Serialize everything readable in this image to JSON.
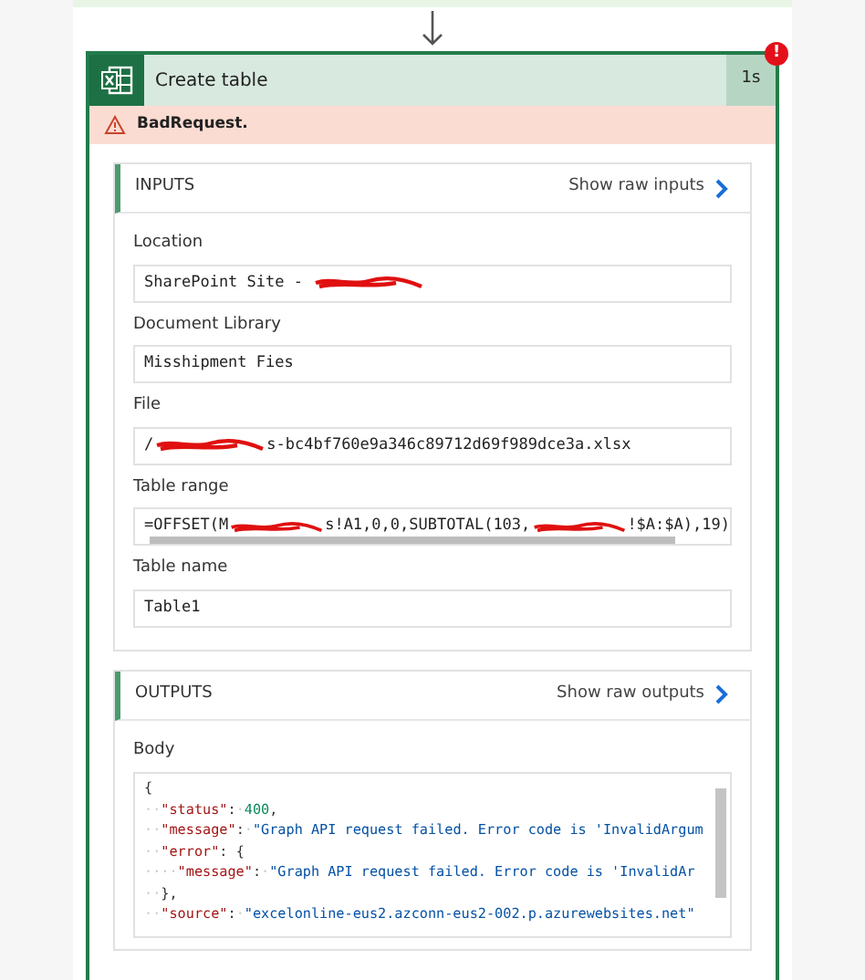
{
  "action": {
    "title": "Create table",
    "duration": "1s",
    "error_badge": "!",
    "error": "BadRequest."
  },
  "inputs": {
    "title": "INPUTS",
    "raw_link": "Show raw inputs",
    "fields": [
      {
        "label": "Location",
        "value": [
          {
            "kind": "text",
            "text": "SharePoint Site - "
          },
          {
            "kind": "redacted"
          }
        ]
      },
      {
        "label": "Document Library",
        "value": [
          {
            "kind": "text",
            "text": "Misshipment Fies"
          }
        ]
      },
      {
        "label": "File",
        "value": [
          {
            "kind": "text",
            "text": "/"
          },
          {
            "kind": "redacted"
          },
          {
            "kind": "text",
            "text": "s-bc4bf760e9a346c89712d69f989dce3a.xlsx"
          }
        ]
      },
      {
        "label": "Table range",
        "value": [
          {
            "kind": "text",
            "text": "=OFFSET(M"
          },
          {
            "kind": "redacted"
          },
          {
            "kind": "text",
            "text": "s!A1,0,0,SUBTOTAL(103,"
          },
          {
            "kind": "redacted"
          },
          {
            "kind": "text",
            "text": "!$A:$A),19)"
          }
        ],
        "scrollable": true
      },
      {
        "label": "Table name",
        "value": [
          {
            "kind": "text",
            "text": "Table1"
          }
        ]
      }
    ]
  },
  "outputs": {
    "title": "OUTPUTS",
    "raw_link": "Show raw outputs",
    "body_label": "Body",
    "code": [
      [
        {
          "kind": "punct",
          "text": "{"
        }
      ],
      [
        {
          "kind": "indent",
          "text": "··"
        },
        {
          "kind": "key",
          "text": "\"status\""
        },
        {
          "kind": "punct",
          "text": ":"
        },
        {
          "kind": "indent",
          "text": "·"
        },
        {
          "kind": "number",
          "text": "400"
        },
        {
          "kind": "punct",
          "text": ","
        }
      ],
      [
        {
          "kind": "indent",
          "text": "··"
        },
        {
          "kind": "key",
          "text": "\"message\""
        },
        {
          "kind": "punct",
          "text": ":"
        },
        {
          "kind": "indent",
          "text": "·"
        },
        {
          "kind": "string",
          "text": "\"Graph API request failed. Error code is 'InvalidArgum"
        }
      ],
      [
        {
          "kind": "indent",
          "text": "··"
        },
        {
          "kind": "key",
          "text": "\"error\""
        },
        {
          "kind": "punct",
          "text": ": {"
        }
      ],
      [
        {
          "kind": "indent",
          "text": "····"
        },
        {
          "kind": "key",
          "text": "\"message\""
        },
        {
          "kind": "punct",
          "text": ":"
        },
        {
          "kind": "indent",
          "text": "·"
        },
        {
          "kind": "string",
          "text": "\"Graph API request failed. Error code is 'InvalidAr"
        }
      ],
      [
        {
          "kind": "indent",
          "text": "··"
        },
        {
          "kind": "punct",
          "text": "},"
        }
      ],
      [
        {
          "kind": "indent",
          "text": "··"
        },
        {
          "kind": "key",
          "text": "\"source\""
        },
        {
          "kind": "punct",
          "text": ":"
        },
        {
          "kind": "indent",
          "text": "·"
        },
        {
          "kind": "string",
          "text": "\"excelonline-eus2.azconn-eus2-002.p.azurewebsites.net\""
        }
      ]
    ]
  }
}
